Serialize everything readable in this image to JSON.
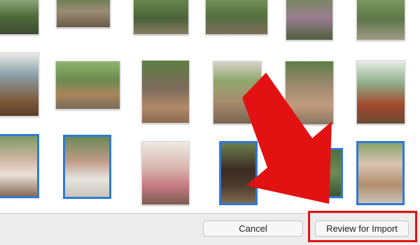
{
  "dialog": {
    "cancel_label": "Cancel",
    "review_label": "Review for Import"
  },
  "photos": [
    {
      "row": 1,
      "col": 1,
      "selected": false
    },
    {
      "row": 1,
      "col": 2,
      "selected": false
    },
    {
      "row": 1,
      "col": 3,
      "selected": false
    },
    {
      "row": 1,
      "col": 4,
      "selected": false
    },
    {
      "row": 1,
      "col": 5,
      "selected": false
    },
    {
      "row": 1,
      "col": 6,
      "selected": false
    },
    {
      "row": 2,
      "col": 1,
      "selected": false
    },
    {
      "row": 2,
      "col": 2,
      "selected": false
    },
    {
      "row": 2,
      "col": 3,
      "selected": false
    },
    {
      "row": 2,
      "col": 4,
      "selected": false
    },
    {
      "row": 2,
      "col": 5,
      "selected": false
    },
    {
      "row": 2,
      "col": 6,
      "selected": false
    },
    {
      "row": 3,
      "col": 1,
      "selected": true
    },
    {
      "row": 3,
      "col": 2,
      "selected": true
    },
    {
      "row": 3,
      "col": 3,
      "selected": false
    },
    {
      "row": 3,
      "col": 4,
      "selected": true
    },
    {
      "row": 3,
      "col": 5,
      "selected": true
    },
    {
      "row": 3,
      "col": 6,
      "selected": true
    }
  ],
  "colors": {
    "selection": "#2f7ad6",
    "annotation": "#e21212"
  }
}
